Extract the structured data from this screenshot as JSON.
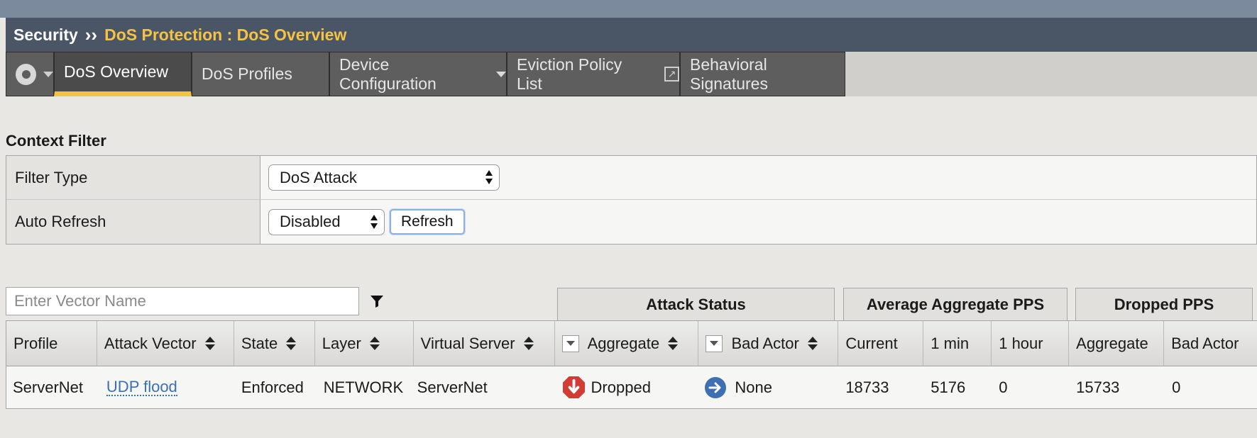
{
  "title": {
    "section": "Security",
    "separator": "››",
    "breadcrumb": "DoS Protection : DoS Overview"
  },
  "tabs": [
    {
      "label": "DoS Overview",
      "active": true
    },
    {
      "label": "DoS Profiles"
    },
    {
      "label": "Device Configuration",
      "dropdown": true
    },
    {
      "label": "Eviction Policy List",
      "external_icon": "external-link-icon"
    },
    {
      "label": "Behavioral Signatures"
    }
  ],
  "context_filter": {
    "title": "Context Filter",
    "filter_type_label": "Filter Type",
    "filter_type_value": "DoS Attack",
    "auto_refresh_label": "Auto Refresh",
    "auto_refresh_value": "Disabled",
    "refresh_button": "Refresh"
  },
  "search": {
    "placeholder": "Enter Vector Name"
  },
  "column_groups": {
    "attack_status": "Attack Status",
    "avg_aggregate_pps": "Average Aggregate PPS",
    "dropped_pps": "Dropped PPS"
  },
  "columns": {
    "profile": "Profile",
    "attack_vector": "Attack Vector",
    "state": "State",
    "layer": "Layer",
    "virtual_server": "Virtual Server",
    "aggregate": "Aggregate",
    "bad_actor": "Bad Actor",
    "current": "Current",
    "one_min": "1 min",
    "one_hour": "1 hour",
    "dropped_aggregate": "Aggregate",
    "dropped_bad_actor": "Bad Actor"
  },
  "rows": [
    {
      "profile": "ServerNet",
      "attack_vector": "UDP flood",
      "state": "Enforced",
      "layer": "NETWORK",
      "virtual_server": "ServerNet",
      "aggregate": "Dropped",
      "bad_actor": "None",
      "current": "18733",
      "one_min": "5176",
      "one_hour": "0",
      "dropped_aggregate": "15733",
      "dropped_bad_actor": "0"
    }
  ],
  "colors": {
    "accent": "#f5c243",
    "title_bar": "#4a5666",
    "tab": "#5e5e5e",
    "link": "#3b6fb5",
    "dropped": "#d33b35",
    "none": "#3f6fb3"
  },
  "icons": [
    "gear-icon",
    "chevron-down-icon",
    "external-link-icon",
    "filter-icon",
    "sort-icon",
    "column-menu-icon",
    "stop-hand-icon",
    "arrow-right-icon"
  ]
}
